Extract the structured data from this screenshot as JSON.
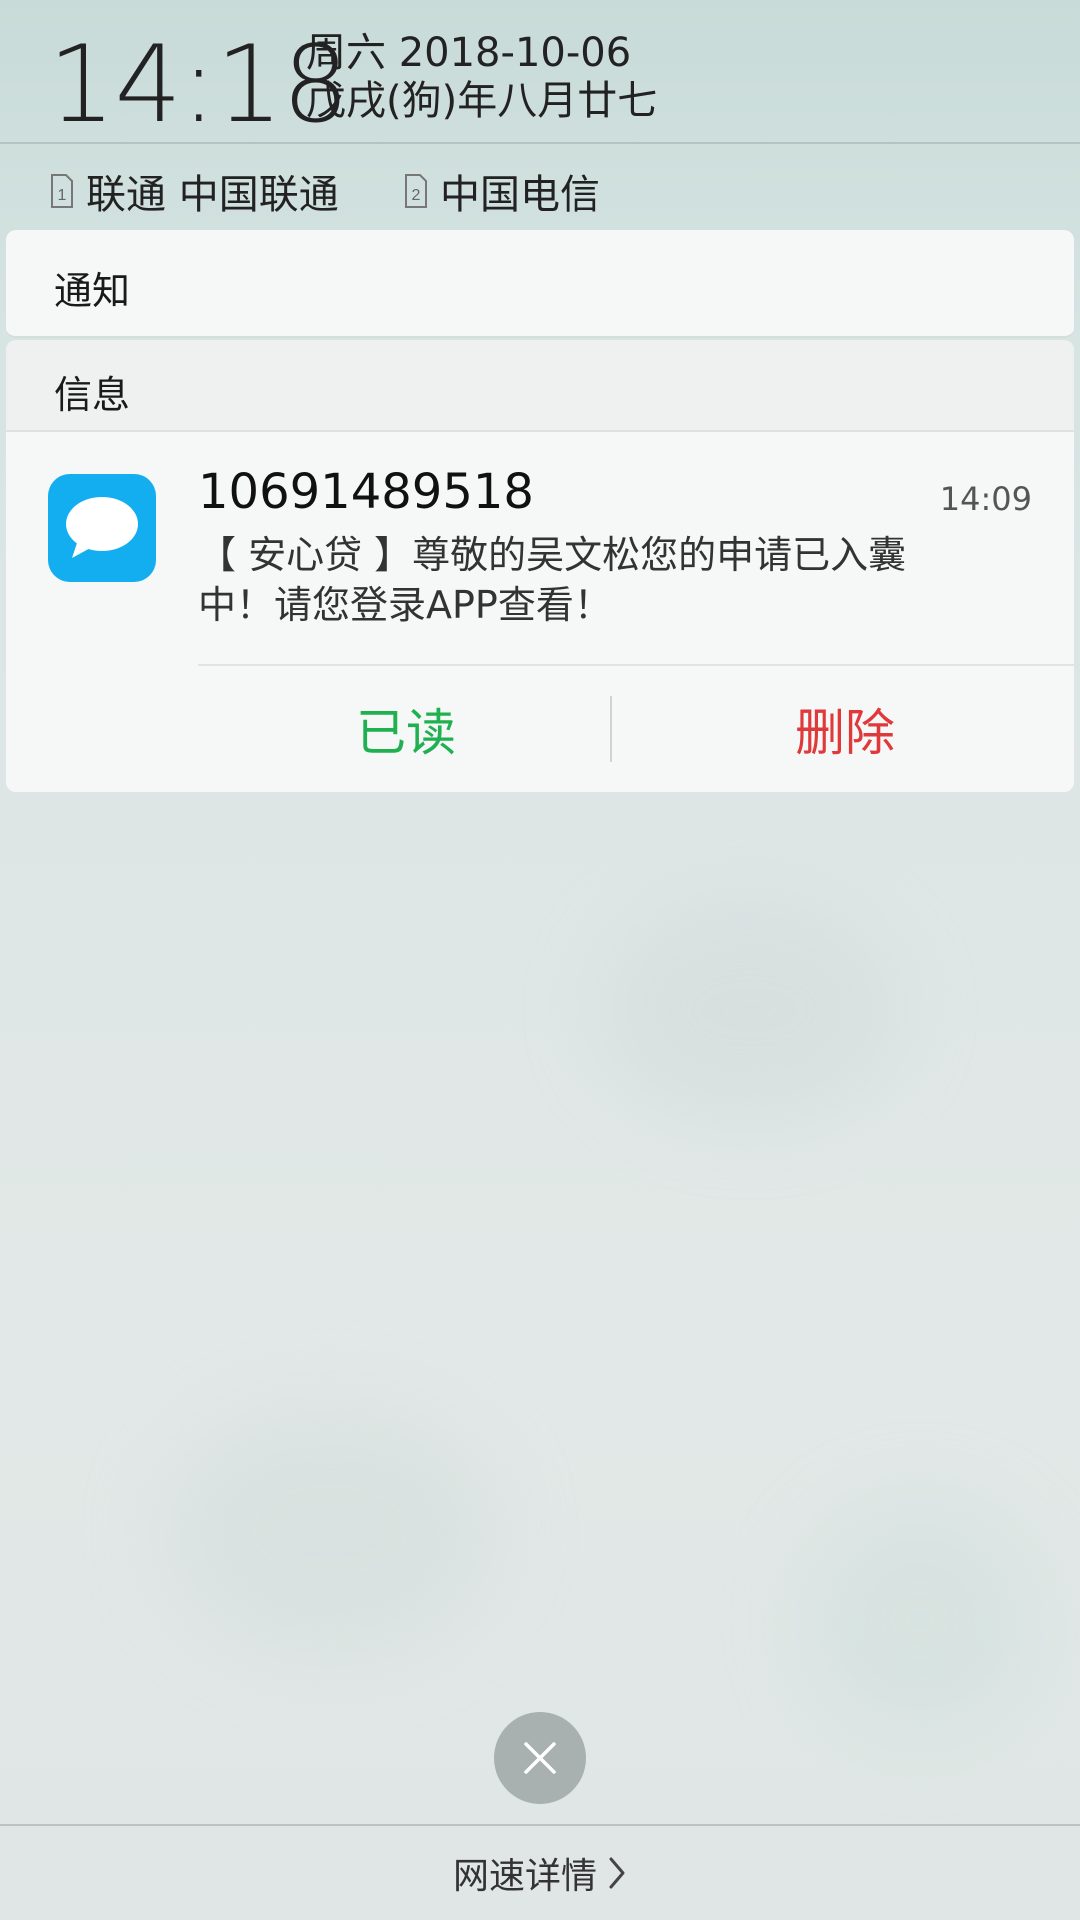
{
  "status": {
    "time": "14:18",
    "date_line": "周六 2018-10-06",
    "lunar_line": "戊戌(狗)年八月廿七"
  },
  "carriers": [
    {
      "sim": "1",
      "name": "联通 中国联通"
    },
    {
      "sim": "2",
      "name": "中国电信"
    }
  ],
  "sections": {
    "notifications_title": "通知",
    "messages_title": "信息"
  },
  "message": {
    "app_icon": "message-bubble-icon",
    "sender": "10691489518",
    "time": "14:09",
    "body": "【 安心贷 】尊敬的吴文松您的申请已入囊中！请您登录APP查看！",
    "actions": {
      "read_label": "已读",
      "delete_label": "删除"
    }
  },
  "footer": {
    "close_icon": "close-icon",
    "net_speed_label": "网速详情"
  },
  "colors": {
    "read": "#1fb14f",
    "delete": "#e0393b",
    "app_icon_bg": "#12aef0"
  }
}
